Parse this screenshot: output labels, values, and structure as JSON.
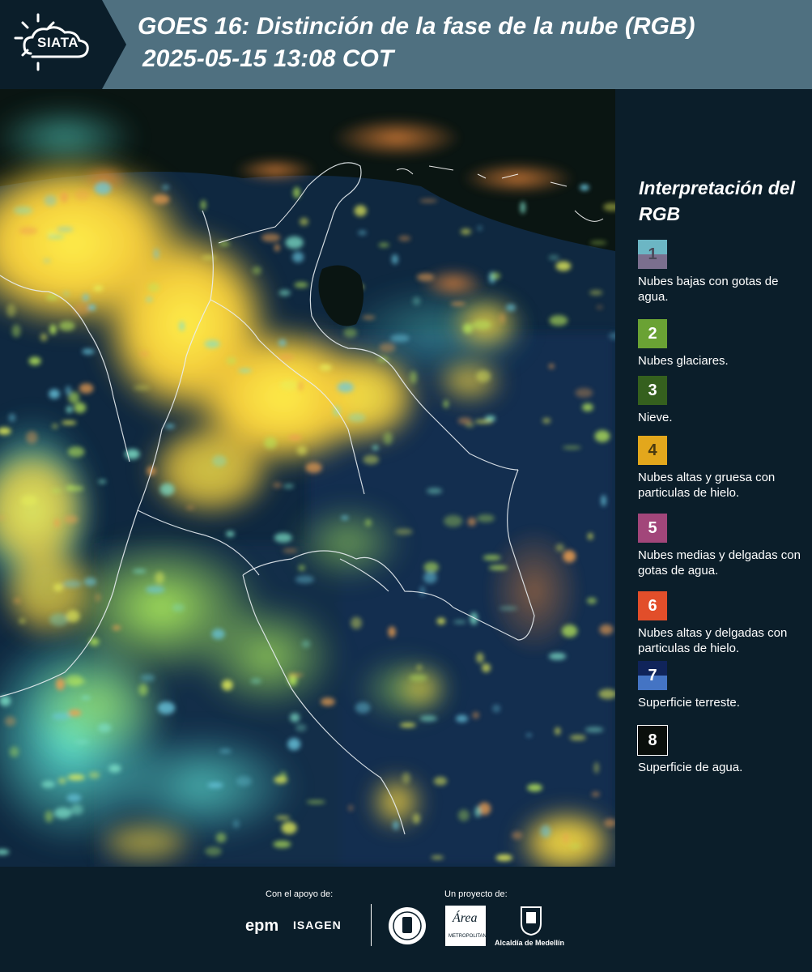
{
  "header": {
    "logo_text": "SIATA",
    "title_line1": "GOES 16: Distinción de la fase de la nube (RGB)",
    "title_line2": "2025-05-15 13:08 COT"
  },
  "legend": {
    "title": "Interpretación del RGB",
    "items": [
      {
        "number": "1",
        "label": "Nubes bajas con gotas de agua.",
        "color_top": "#6cb6c4",
        "color_bottom": "#7b6f8e",
        "number_color": "#4a4a5a"
      },
      {
        "number": "2",
        "label": "Nubes glaciares.",
        "color_top": "#6aa234",
        "color_bottom": "#6aa234",
        "number_color": "#ffffff"
      },
      {
        "number": "3",
        "label": "Nieve.",
        "color_top": "#35601e",
        "color_bottom": "#35601e",
        "number_color": "#ffffff"
      },
      {
        "number": "4",
        "label": "Nubes altas y gruesa con particulas de hielo.",
        "color_top": "#e3a71c",
        "color_bottom": "#e3a71c",
        "number_color": "#4a3a10"
      },
      {
        "number": "5",
        "label": "Nubes medias y delgadas con gotas de agua.",
        "color_top": "#a2467a",
        "color_bottom": "#a2467a",
        "number_color": "#ffffff"
      },
      {
        "number": "6",
        "label": "Nubes altas y delgadas con particulas de hielo.",
        "color_top": "#e24e2a",
        "color_bottom": "#e24e2a",
        "number_color": "#ffffff"
      },
      {
        "number": "7",
        "label": "Superficie terreste.",
        "color_top": "#10245a",
        "color_bottom": "#4474c4",
        "number_color": "#ffffff"
      },
      {
        "number": "8",
        "label": "Superficie de agua.",
        "color_top": "#0a0f0c",
        "color_bottom": "#0a0f0c",
        "number_color": "#ffffff"
      }
    ]
  },
  "footer": {
    "support_label": "Con el apoyo de:",
    "project_label": "Un proyecto de:",
    "sponsor1": "epm",
    "sponsor2": "ISAGEN",
    "area_logo_text": "Área",
    "area_small_text": "METROPOLITANA",
    "alcaldia_text": "Alcaldía de Medellín"
  }
}
